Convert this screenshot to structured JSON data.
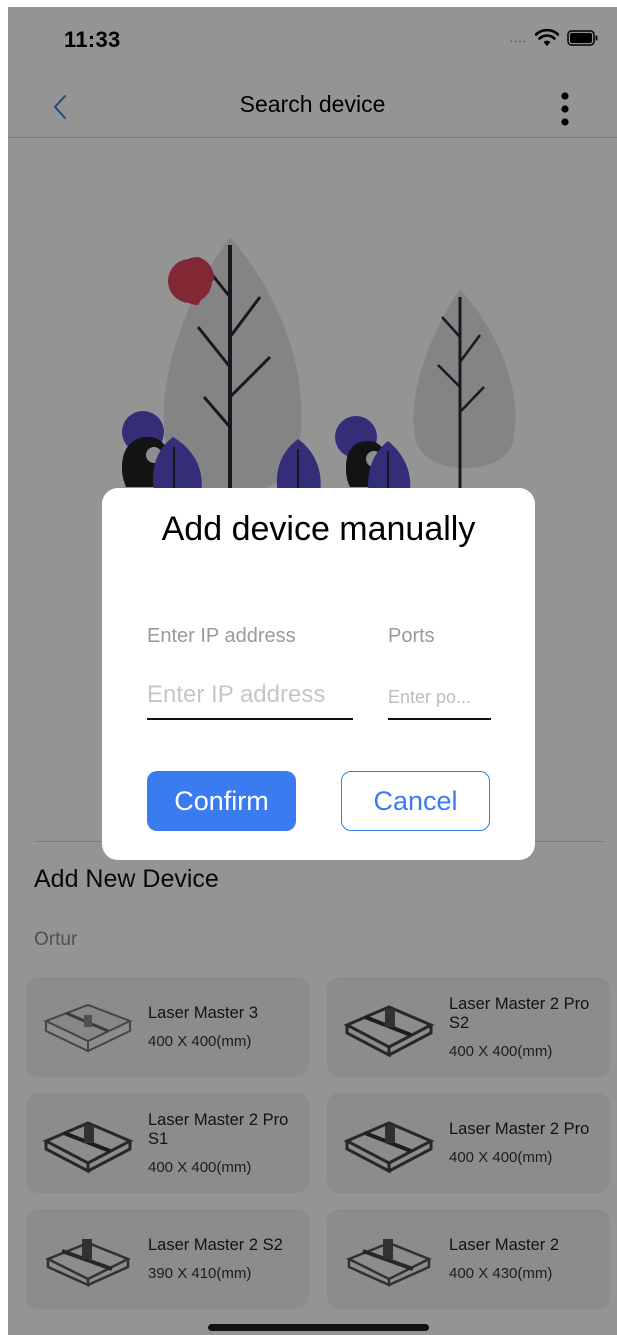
{
  "status_bar": {
    "time": "11:33",
    "signal": "....",
    "wifi_icon": "wifi-icon",
    "battery_icon": "battery-icon"
  },
  "nav": {
    "title": "Search device",
    "back_icon": "chevron-left-icon",
    "more_icon": "more-vertical-icon"
  },
  "modal": {
    "title": "Add device manually",
    "ip_label": "Enter IP address",
    "ip_placeholder": "Enter IP address",
    "ip_value": "",
    "port_label": "Ports",
    "port_placeholder": "Enter po...",
    "port_value": "",
    "confirm_label": "Confirm",
    "cancel_label": "Cancel"
  },
  "add_device": {
    "title": "Add New Device",
    "brand": "Ortur",
    "devices": [
      {
        "name": "Laser Master 3",
        "size": "400 X 400(mm)"
      },
      {
        "name": "Laser Master 2 Pro S2",
        "size": "400 X 400(mm)"
      },
      {
        "name": "Laser Master 2 Pro S1",
        "size": "400 X 400(mm)"
      },
      {
        "name": "Laser Master 2 Pro",
        "size": "400 X 400(mm)"
      },
      {
        "name": "Laser Master 2 S2",
        "size": "390 X 410(mm)"
      },
      {
        "name": "Laser Master 2",
        "size": "400 X 430(mm)"
      }
    ]
  },
  "colors": {
    "accent": "#3a7bf0",
    "purple": "#5a4fcf",
    "red": "#e0445a",
    "card_bg": "#f2f2f2"
  }
}
